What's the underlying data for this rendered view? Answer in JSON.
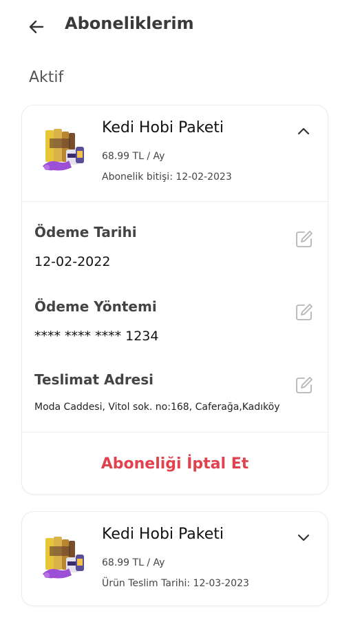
{
  "header": {
    "title": "Aboneliklerim",
    "back_icon": "arrow-left-icon"
  },
  "section": {
    "label": "Aktif"
  },
  "subscriptions": [
    {
      "name": "Kedi Hobi Paketi",
      "price": "68.99 TL / Ay",
      "date_text": "Abonelik bitişi: 12-02-2023",
      "expanded": true,
      "chevron_icon": "chevron-up-icon",
      "details": [
        {
          "label": "Ödeme Tarihi",
          "value": "12-02-2022",
          "edit_icon": "edit-icon"
        },
        {
          "label": "Ödeme Yöntemi",
          "value": "**** **** **** 1234",
          "edit_icon": "edit-icon"
        },
        {
          "label": "Teslimat Adresi",
          "value": "Moda Caddesi, Vitol sok. no:168, Caferağa,Kadıköy",
          "edit_icon": "edit-icon"
        }
      ],
      "cancel_label": "Aboneliği İptal Et"
    },
    {
      "name": "Kedi Hobi Paketi",
      "price": "68.99 TL / Ay",
      "date_text": "Ürün Teslim  Tarihi: 12-03-2023",
      "expanded": false,
      "chevron_icon": "chevron-down-icon"
    }
  ],
  "colors": {
    "accent_cancel": "#e0434d",
    "title_text": "#3a3a3a",
    "card_border": "#ececec"
  }
}
